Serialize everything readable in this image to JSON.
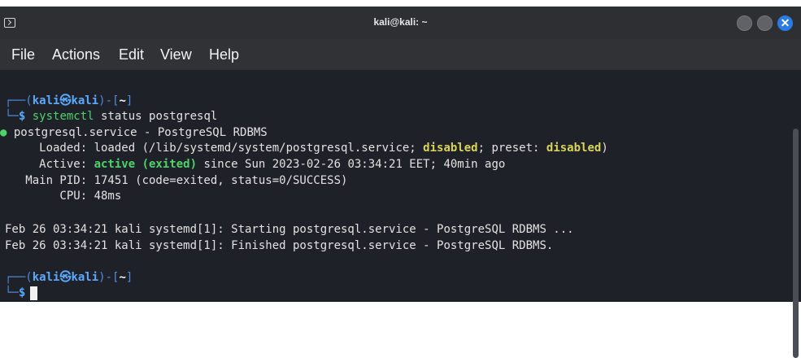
{
  "window": {
    "title": "kali@kali: ~"
  },
  "menu": [
    "File",
    "Actions",
    "Edit",
    "View",
    "Help"
  ],
  "terminal": {
    "prompt1": {
      "open": "┌──(",
      "user": "kali",
      "at": "㉿",
      "host": "kali",
      "close": ")-[",
      "dir": "~",
      "end": "]"
    },
    "cmd_line": {
      "prefix": "└─",
      "sym": "$",
      "cmd": "systemctl",
      "args": " status postgresql"
    },
    "status_head": {
      "bullet": "●",
      "text": " postgresql.service - PostgreSQL RDBMS"
    },
    "loaded": {
      "label": "     Loaded: ",
      "t1": "loaded (/lib/systemd/system/postgresql.service; ",
      "s1": "disabled",
      "t2": "; preset: ",
      "s2": "disabled",
      "t3": ")"
    },
    "active": {
      "label": "     Active: ",
      "state": "active (exited)",
      "rest": " since Sun 2023-02-26 03:34:21 EET; 40min ago"
    },
    "main_pid": "   Main PID: 17451 (code=exited, status=0/SUCCESS)",
    "cpu": "        CPU: 48ms",
    "log1": "Feb 26 03:34:21 kali systemd[1]: Starting postgresql.service - PostgreSQL RDBMS ...",
    "log2": "Feb 26 03:34:21 kali systemd[1]: Finished postgresql.service - PostgreSQL RDBMS.",
    "prompt2": {
      "open": "┌──(",
      "user": "kali",
      "at": "㉿",
      "host": "kali",
      "close": ")-[",
      "dir": "~",
      "end": "]"
    },
    "cmd_line2": {
      "prefix": "└─",
      "sym": "$"
    }
  },
  "colors": {
    "prompt_blue": "#5aa9ff",
    "active_green": "#4fd16b",
    "disabled_yellow": "#d8d35a",
    "close_button": "#2c7be5"
  },
  "icons": {
    "app": "terminal-icon",
    "close": "close-icon"
  }
}
